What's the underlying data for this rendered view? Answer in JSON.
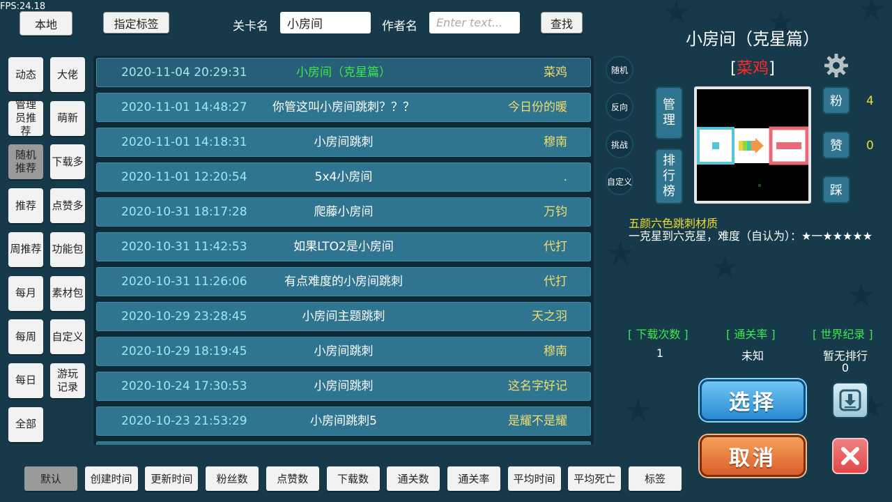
{
  "fps": "FPS:24.18",
  "top": {
    "local_btn": "本地",
    "tag_btn": "指定标签",
    "level_label": "关卡名",
    "level_value": "小房间",
    "author_label": "作者名",
    "author_placeholder": "Enter text...",
    "search_btn": "查找"
  },
  "categories": [
    {
      "label": "动态",
      "active": false
    },
    {
      "label": "大佬",
      "active": false
    },
    {
      "label": "管理员推荐",
      "active": false
    },
    {
      "label": "萌新",
      "active": false
    },
    {
      "label": "随机推荐",
      "active": true
    },
    {
      "label": "下载多",
      "active": false
    },
    {
      "label": "推荐",
      "active": false
    },
    {
      "label": "点赞多",
      "active": false
    },
    {
      "label": "周推荐",
      "active": false
    },
    {
      "label": "功能包",
      "active": false
    },
    {
      "label": "每月",
      "active": false
    },
    {
      "label": "素材包",
      "active": false
    },
    {
      "label": "每周",
      "active": false
    },
    {
      "label": "自定义",
      "active": false
    },
    {
      "label": "每日",
      "active": false
    },
    {
      "label": "游玩记录",
      "active": false
    },
    {
      "label": "全部",
      "active": false
    }
  ],
  "levels": [
    {
      "date": "2020-11-04 20:29:31",
      "name": "小房间（克星篇）",
      "author": "菜鸡",
      "selected": true
    },
    {
      "date": "2020-11-01 14:48:27",
      "name": "你管这叫小房间跳刺？？？",
      "author": "今日份的暖",
      "selected": false
    },
    {
      "date": "2020-11-01 14:18:31",
      "name": "小房间跳刺",
      "author": "穆南",
      "selected": false
    },
    {
      "date": "2020-11-01 12:20:54",
      "name": "5x4小房间",
      "author": ".",
      "selected": false
    },
    {
      "date": "2020-10-31 18:17:28",
      "name": "爬藤小房间",
      "author": "万钧",
      "selected": false
    },
    {
      "date": "2020-10-31 11:42:53",
      "name": "如果LTO2是小房间",
      "author": "代打",
      "selected": false
    },
    {
      "date": "2020-10-31 11:26:06",
      "name": "有点难度的小房间跳刺",
      "author": "代打",
      "selected": false
    },
    {
      "date": "2020-10-29 23:28:45",
      "name": "小房间主题跳刺",
      "author": "天之羽",
      "selected": false
    },
    {
      "date": "2020-10-29 18:19:45",
      "name": "小房间跳刺",
      "author": "穆南",
      "selected": false
    },
    {
      "date": "2020-10-24 17:30:53",
      "name": "小房间跳刺",
      "author": "这名字好记",
      "selected": false
    },
    {
      "date": "2020-10-23 21:53:29",
      "name": "小房间跳刺5",
      "author": "是耀不是耀",
      "selected": false
    }
  ],
  "side_round": [
    "随机",
    "反向",
    "挑战",
    "自定义"
  ],
  "manage_btn": "管理",
  "rank_btn": "排行榜",
  "detail": {
    "title": "小房间（克星篇）",
    "author_prefix": "[",
    "author": "菜鸡",
    "author_suffix": "]",
    "fans_label": "粉",
    "fans_count": "4",
    "like_label": "赞",
    "like_count": "0",
    "dislike_label": "踩",
    "desc_line1": "五颜六色跳刺材质",
    "desc_line2": "一克星到六克星，难度（自认为）：★一★★★★★",
    "downloads_header": "[ 下载次数 ]",
    "clear_rate_header": "[ 通关率 ]",
    "world_record_header": "[ 世界纪录 ]",
    "downloads_value": "1",
    "clear_rate_value": "未知",
    "world_record_value": "暂无排行",
    "world_record_sub": "0"
  },
  "select_btn": "选择",
  "cancel_btn": "取消",
  "sort": [
    {
      "label": "默认",
      "active": true
    },
    {
      "label": "创建时间",
      "active": false
    },
    {
      "label": "更新时间",
      "active": false
    },
    {
      "label": "粉丝数",
      "active": false
    },
    {
      "label": "点赞数",
      "active": false
    },
    {
      "label": "下载数",
      "active": false
    },
    {
      "label": "通关数",
      "active": false
    },
    {
      "label": "通关率",
      "active": false
    },
    {
      "label": "平均时间",
      "active": false
    },
    {
      "label": "平均死亡",
      "active": false
    },
    {
      "label": "标签",
      "active": false
    }
  ],
  "colors": {
    "background": "#163a4a",
    "row": "#2f7590",
    "date_text": "#9de8f2",
    "author_text": "#f0dc70",
    "highlight_green": "#3ee84a",
    "red": "#ff2a2a"
  }
}
